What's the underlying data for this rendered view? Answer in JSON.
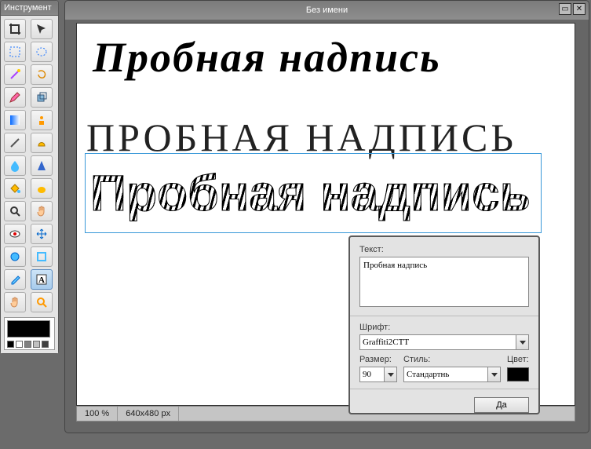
{
  "toolbox": {
    "title": "Инструмент",
    "tools": [
      "crop",
      "pointer",
      "rect-select",
      "ellipse-select",
      "wand",
      "lasso",
      "pencil",
      "clone",
      "gradient",
      "figure",
      "line",
      "shape",
      "blur",
      "sharpen",
      "fill",
      "smudge",
      "zoom",
      "hand",
      "redeye",
      "move",
      "dodge",
      "burn",
      "eyedrop",
      "text",
      "pan",
      "find"
    ],
    "active_tool": "text",
    "fg_color": "#000000",
    "palette": [
      "#000000",
      "#ffffff",
      "#808080",
      "#c0c0c0",
      "#404040"
    ]
  },
  "document": {
    "title": "Без имени",
    "zoom": "100 %",
    "dimensions": "640x480 px",
    "sample_text_1": "Пробная  надпись",
    "sample_text_2": "ПРОБНАЯ НАДПИСЬ",
    "sample_text_3": "Пробная надпись"
  },
  "text_tool": {
    "label_text": "Текст:",
    "value": "Пробная надпись",
    "label_font": "Шрифт:",
    "font": "Graffiti2CTT",
    "label_size": "Размер:",
    "size": "90",
    "label_style": "Стиль:",
    "style": "Стандартнь",
    "label_color": "Цвет:",
    "color": "#000000",
    "ok": "Да"
  }
}
